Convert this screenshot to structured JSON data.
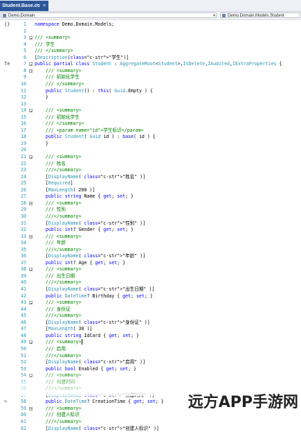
{
  "tab": {
    "title": "Student.Base.cs",
    "pin_icon": "pin-icon",
    "close_label": "×"
  },
  "navbar": {
    "left": "Demo.Domain",
    "right": "Demo.Domain.Models.Student"
  },
  "current_line": "49",
  "watermark": "远方APP手游网",
  "lines": [
    {
      "n": "1",
      "t": "namespace Demo.Domain.Models;"
    },
    {
      "n": "2",
      "t": ""
    },
    {
      "n": "3",
      "t": "/// <summary>"
    },
    {
      "n": "4",
      "t": "/// 学生"
    },
    {
      "n": "5",
      "t": "/// </summary>"
    },
    {
      "n": "6",
      "t": "[Description(\"学生\")]"
    },
    {
      "n": "7",
      "t": "public partial class Student : AggregateRoot<Student>,ISDelete,IAudited,IExtraProperties {"
    },
    {
      "n": "8",
      "t": "    /// <summary>"
    },
    {
      "n": "9",
      "t": "    /// 初始化学生"
    },
    {
      "n": "10",
      "t": "    /// </summary>"
    },
    {
      "n": "11",
      "t": "    public Student() : this( Guid.Empty ) {"
    },
    {
      "n": "12",
      "t": "    }"
    },
    {
      "n": "13",
      "t": ""
    },
    {
      "n": "14",
      "t": "    /// <summary>"
    },
    {
      "n": "15",
      "t": "    /// 初始化学生"
    },
    {
      "n": "16",
      "t": "    /// </summary>"
    },
    {
      "n": "17",
      "t": "    /// <param name=\"id\">学生标识</param>"
    },
    {
      "n": "18",
      "t": "    public Student( Guid id ) : base( id ) {"
    },
    {
      "n": "19",
      "t": "    }"
    },
    {
      "n": "20",
      "t": ""
    },
    {
      "n": "21",
      "t": "    /// <summary>"
    },
    {
      "n": "22",
      "t": "    /// 姓名"
    },
    {
      "n": "23",
      "t": "    ///</summary>"
    },
    {
      "n": "24",
      "t": "    [DisplayName( \"姓名\" )]"
    },
    {
      "n": "25",
      "t": "    [Required]"
    },
    {
      "n": "26",
      "t": "    [MaxLength( 200 )]"
    },
    {
      "n": "27",
      "t": "    public string Name { get; set; }"
    },
    {
      "n": "28",
      "t": "    /// <summary>"
    },
    {
      "n": "29",
      "t": "    /// 性别"
    },
    {
      "n": "30",
      "t": "    ///</summary>"
    },
    {
      "n": "31",
      "t": "    [DisplayName( \"性别\" )]"
    },
    {
      "n": "32",
      "t": "    public int? Gender { get; set; }"
    },
    {
      "n": "33",
      "t": "    /// <summary>"
    },
    {
      "n": "34",
      "t": "    /// 年龄"
    },
    {
      "n": "35",
      "t": "    ///</summary>"
    },
    {
      "n": "36",
      "t": "    [DisplayName( \"年龄\" )]"
    },
    {
      "n": "37",
      "t": "    public int? Age { get; set; }"
    },
    {
      "n": "38",
      "t": "    /// <summary>"
    },
    {
      "n": "39",
      "t": "    /// 出生日期"
    },
    {
      "n": "40",
      "t": "    ///</summary>"
    },
    {
      "n": "41",
      "t": "    [DisplayName( \"出生日期\" )]"
    },
    {
      "n": "42",
      "t": "    public DateTime? Birthday { get; set; }"
    },
    {
      "n": "43",
      "t": "    /// <summary>"
    },
    {
      "n": "44",
      "t": "    /// 身份证"
    },
    {
      "n": "45",
      "t": "    ///</summary>"
    },
    {
      "n": "46",
      "t": "    [DisplayName( \"身份证\" )]"
    },
    {
      "n": "47",
      "t": "    [MaxLength( 30 )]"
    },
    {
      "n": "48",
      "t": "    public string IdCard { get; set; }"
    },
    {
      "n": "49",
      "t": "    /// <summary>"
    },
    {
      "n": "50",
      "t": "    /// 启用"
    },
    {
      "n": "51",
      "t": "    ///</summary>"
    },
    {
      "n": "52",
      "t": "    [DisplayName( \"启用\" )]"
    },
    {
      "n": "53",
      "t": "    public bool Enabled { get; set; }"
    },
    {
      "n": "54",
      "t": "    /// <summary>"
    },
    {
      "n": "55",
      "t": "    /// 创建时间"
    },
    {
      "n": "56",
      "t": "    ///</summary>"
    },
    {
      "n": "57",
      "t": "    [DisplayName( \"创建时间\" )]"
    },
    {
      "n": "58",
      "t": "    public DateTime? CreationTime { get; set; }"
    },
    {
      "n": "59",
      "t": "    /// <summary>"
    },
    {
      "n": "60",
      "t": "    /// 创建人标识"
    },
    {
      "n": "61",
      "t": "    ///</summary>"
    },
    {
      "n": "62",
      "t": "    [DisplayName( \"创建人标识\" )]"
    }
  ],
  "folds": [
    "3",
    "7",
    "8",
    "14",
    "21",
    "28",
    "33",
    "38",
    "43",
    "49",
    "54",
    "59"
  ],
  "glyphs": [
    {
      "line": "1",
      "icon": "refs-icon",
      "char": "{}"
    },
    {
      "line": "7",
      "icon": "class-ref-icon",
      "char": "Te"
    },
    {
      "line": "58",
      "icon": "edit-glyph-icon",
      "char": "✎"
    }
  ]
}
